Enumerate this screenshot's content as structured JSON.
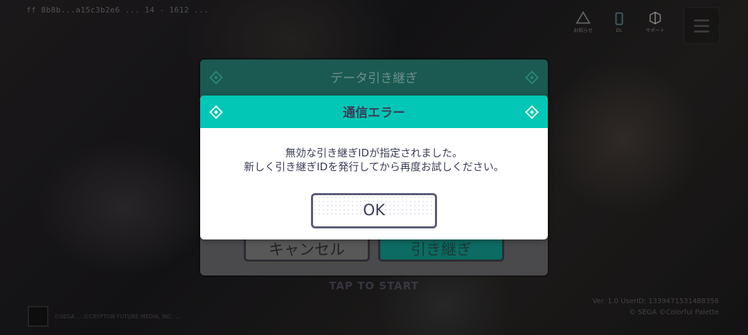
{
  "background": {
    "top_info": "ff 8b8b...a15c3b2e6 ... 14 - 1612 ...",
    "tap_to_start": "TAP TO START",
    "bottom_left_text": "©SEGA ... ©CRYPTON FUTURE MEDIA, INC. ...",
    "bottom_right_line1": "Ver. 1.0  UserID: 1339471531488356",
    "bottom_right_line2": "© SEGA  ©Colorful Palette"
  },
  "top_icons": [
    {
      "name": "notice-icon",
      "caption": "お知らせ"
    },
    {
      "name": "download-icon",
      "caption": "DL"
    },
    {
      "name": "support-icon",
      "caption": "サポート"
    }
  ],
  "back_dialog": {
    "title": "データ引き継ぎ",
    "cancel_label": "キャンセル",
    "confirm_label": "引き継ぎ"
  },
  "error_dialog": {
    "title": "通信エラー",
    "message_line1": "無効な引き継ぎIDが指定されました。",
    "message_line2": "新しく引き継ぎIDを発行してから再度お試しください。",
    "ok_label": "OK"
  },
  "colors": {
    "accent": "#03c7b6",
    "text": "#3b3d58"
  }
}
